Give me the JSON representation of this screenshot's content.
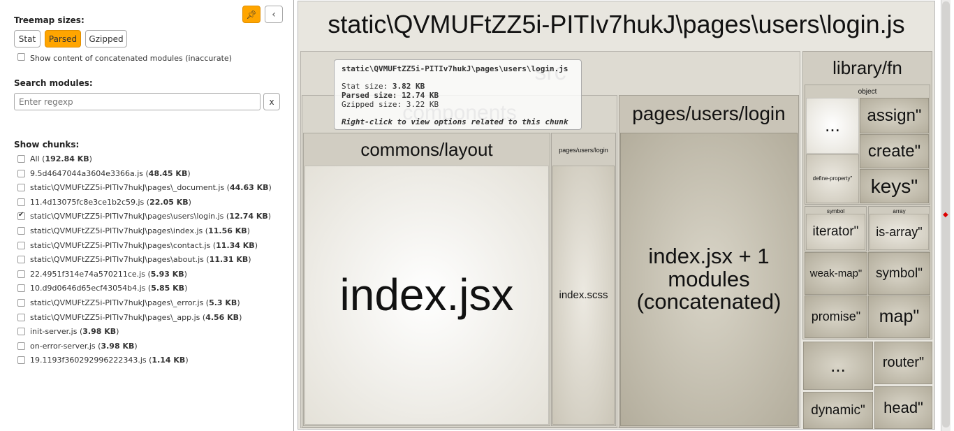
{
  "sidebar": {
    "treemap_sizes_label": "Treemap sizes:",
    "size_buttons": [
      {
        "label": "Stat",
        "active": false
      },
      {
        "label": "Parsed",
        "active": true
      },
      {
        "label": "Gzipped",
        "active": false
      }
    ],
    "pin_icon": "pin-icon",
    "collapse_icon": "chevron-left-icon",
    "concat_label": "Show content of concatenated modules (inaccurate)",
    "search_label": "Search modules:",
    "search_placeholder": "Enter regexp",
    "search_clear": "x",
    "show_chunks_label": "Show chunks:",
    "chunks": [
      {
        "name": "All",
        "size": "192.84 KB",
        "checked": false
      },
      {
        "name": "9.5d4647044a3604e3366a.js",
        "size": "48.45 KB",
        "checked": false
      },
      {
        "name": "static\\QVMUFtZZ5i-PITIv7hukJ\\pages\\_document.js",
        "size": "44.63 KB",
        "checked": false
      },
      {
        "name": "11.4d13075fc8e3ce1b2c59.js",
        "size": "22.05 KB",
        "checked": false
      },
      {
        "name": "static\\QVMUFtZZ5i-PITIv7hukJ\\pages\\users\\login.js",
        "size": "12.74 KB",
        "checked": true
      },
      {
        "name": "static\\QVMUFtZZ5i-PITIv7hukJ\\pages\\index.js",
        "size": "11.56 KB",
        "checked": false
      },
      {
        "name": "static\\QVMUFtZZ5i-PITIv7hukJ\\pages\\contact.js",
        "size": "11.34 KB",
        "checked": false
      },
      {
        "name": "static\\QVMUFtZZ5i-PITIv7hukJ\\pages\\about.js",
        "size": "11.31 KB",
        "checked": false
      },
      {
        "name": "22.4951f314e74a570211ce.js",
        "size": "5.93 KB",
        "checked": false
      },
      {
        "name": "10.d9d0646d65ecf43054b4.js",
        "size": "5.85 KB",
        "checked": false
      },
      {
        "name": "static\\QVMUFtZZ5i-PITIv7hukJ\\pages\\_error.js",
        "size": "5.3 KB",
        "checked": false
      },
      {
        "name": "static\\QVMUFtZZ5i-PITIv7hukJ\\pages\\_app.js",
        "size": "4.56 KB",
        "checked": false
      },
      {
        "name": "init-server.js",
        "size": "3.98 KB",
        "checked": false
      },
      {
        "name": "on-error-server.js",
        "size": "3.98 KB",
        "checked": false
      },
      {
        "name": "19.1193f360292996222343.js",
        "size": "1.14 KB",
        "checked": false
      }
    ]
  },
  "treemap": {
    "root_title": "static\\QVMUFtZZ5i-PITIv7hukJ\\pages\\users\\login.js",
    "src": "src",
    "components": "components",
    "commons_layout": "commons/layout",
    "index_jsx": "index.jsx",
    "pages_users_login_small": "pages/users/login",
    "index_scss": "index.scss",
    "pages_users_login": "pages/users/login",
    "concatenated": "index.jsx + 1 modules (concatenated)",
    "library_fn": "library/fn",
    "object": "object",
    "ellipsis": "...",
    "assign": "assign\"",
    "create": "create\"",
    "define_property": "define-property\"",
    "keys": "keys\"",
    "symbol_group": "symbol",
    "iterator": "iterator\"",
    "array_group": "array",
    "is_array": "is-array\"",
    "weak_map": "weak-map\"",
    "symbol": "symbol\"",
    "promise": "promise\"",
    "map": "map\"",
    "ellipsis2": "...",
    "router": "router\"",
    "dynamic": "dynamic\"",
    "head": "head\""
  },
  "tooltip": {
    "title": "static\\QVMUFtZZ5i-PITIv7hukJ\\pages\\users\\login.js",
    "stat_label": "Stat size:",
    "stat_value": "3.82 KB",
    "parsed_label": "Parsed size:",
    "parsed_value": "12.74 KB",
    "gzip_label": "Gzipped size:",
    "gzip_value": "3.22 KB",
    "hint": "Right-click to view options related to this chunk"
  },
  "colors": {
    "accent": "#ffa500",
    "cell_dark": "#b3ad9c",
    "cell_light": "#e4e1d8"
  }
}
